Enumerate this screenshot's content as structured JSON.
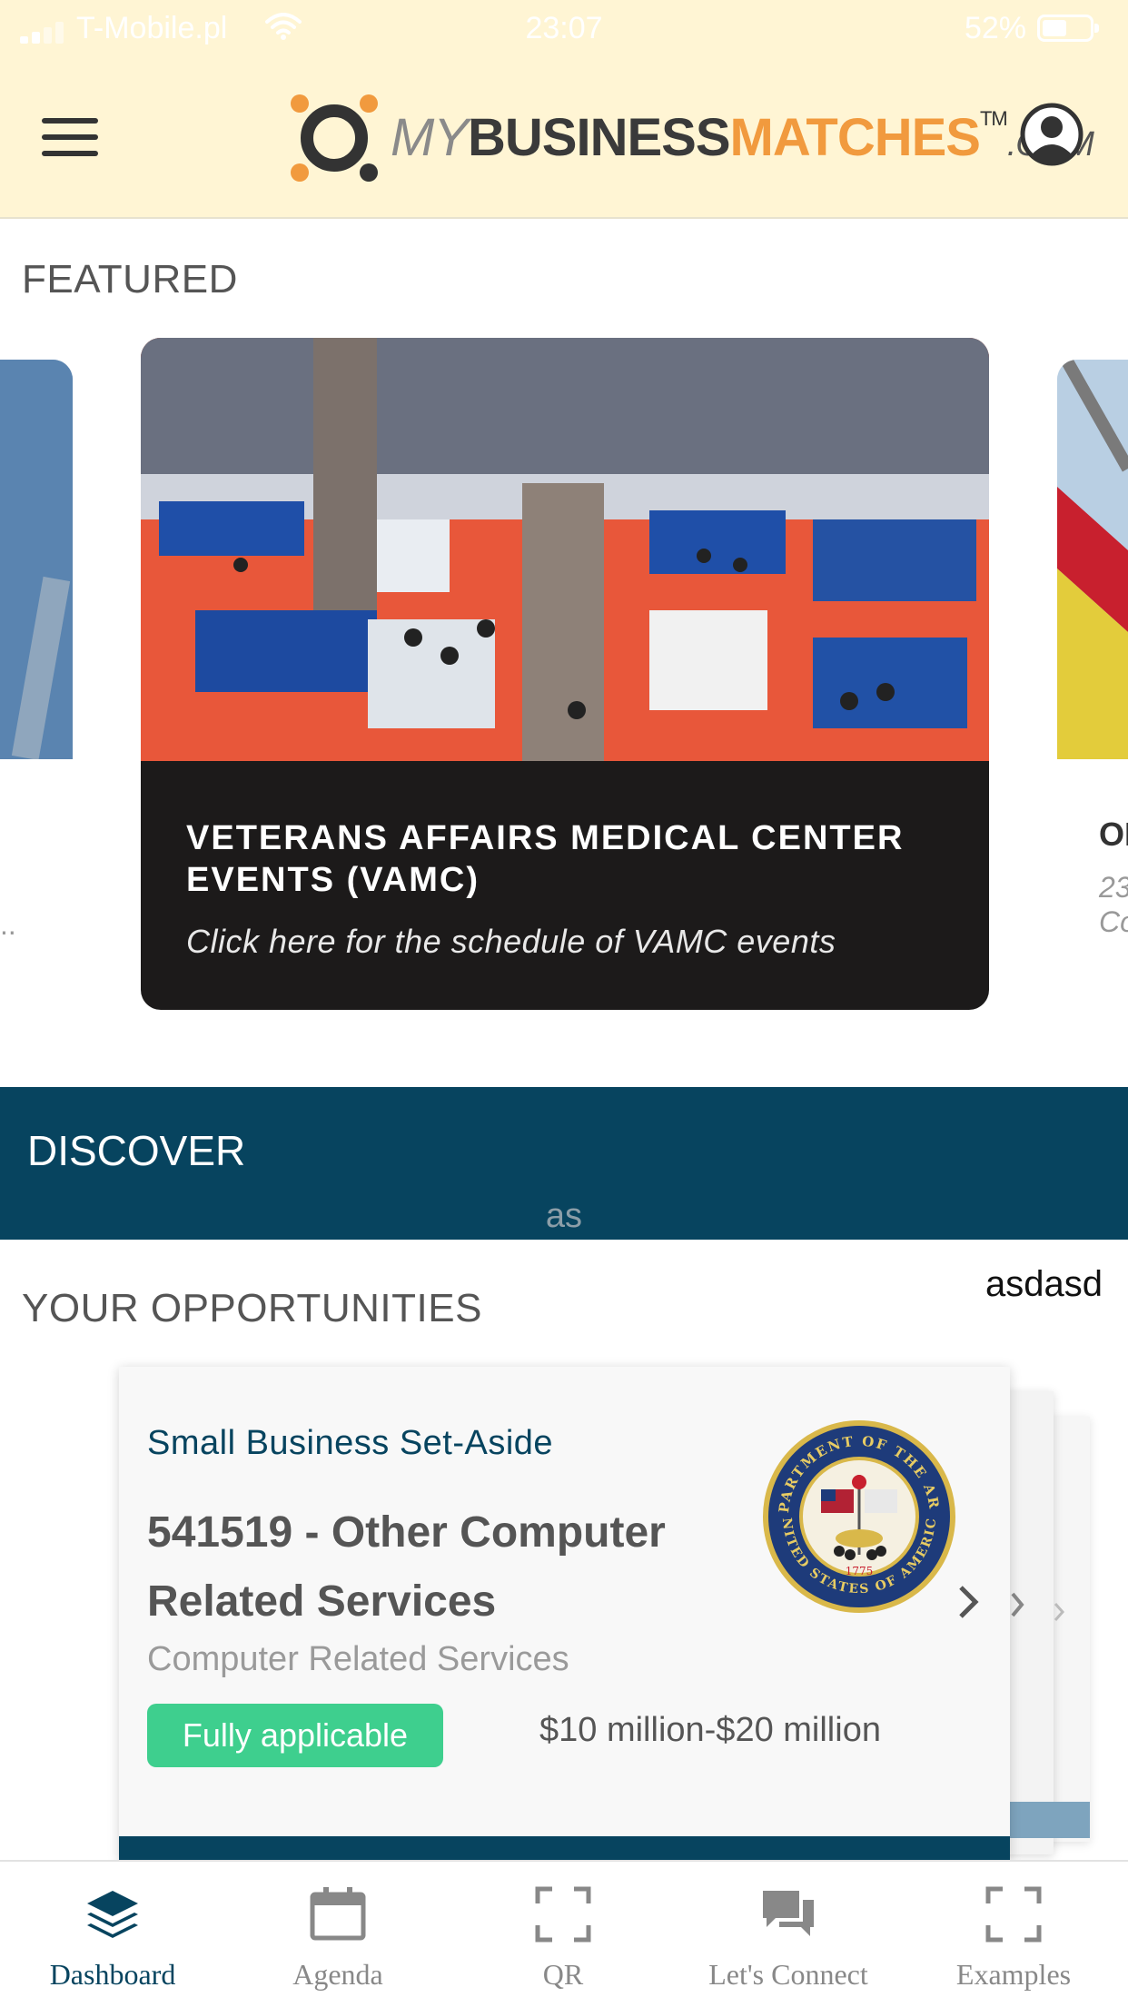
{
  "status_bar": {
    "carrier": "T-Mobile.pl",
    "time": "23:07",
    "battery": "52%"
  },
  "header": {
    "logo": {
      "my": "MY",
      "business": "BUSINESS",
      "matches": "MATCHES",
      "tm": "TM",
      "com": ".COM"
    },
    "icons": {
      "menu": "hamburger-menu-icon",
      "profile": "user-profile-icon"
    }
  },
  "featured": {
    "title": "FEATURED",
    "card": {
      "heading": "VETERANS AFFAIRS MEDICAL CENTER EVENTS (VAMC)",
      "subtitle": "Click here for the schedule of VAMC events"
    },
    "right_peek": {
      "title": "OI",
      "line1": "23",
      "line2": "Co"
    },
    "left_peek": {
      "text": ".."
    }
  },
  "discover": {
    "title": "DISCOVER",
    "caption": "as"
  },
  "opportunities": {
    "title": "YOUR OPPORTUNITIES",
    "extra_text": "asdasd",
    "card": {
      "type": "Small Business Set-Aside",
      "name": "541519 - Other Computer Related Services",
      "subtitle": "Computer Related Services",
      "badge": "Fully applicable",
      "value": "$10 million-$20 million",
      "seal": {
        "top": "DEPARTMENT OF THE ARMY",
        "bottom": "UNITED STATES OF AMERICA",
        "year": "1775"
      }
    }
  },
  "tabbar": {
    "tabs": [
      {
        "label": "Dashboard",
        "icon": "layers-icon",
        "active": true
      },
      {
        "label": "Agenda",
        "icon": "calendar-icon",
        "active": false
      },
      {
        "label": "QR",
        "icon": "qr-scan-icon",
        "active": false
      },
      {
        "label": "Let's Connect",
        "icon": "chat-bubbles-icon",
        "active": false
      },
      {
        "label": "Examples",
        "icon": "scan-frame-icon",
        "active": false
      }
    ]
  },
  "colors": {
    "header_bg": "#fff5d4",
    "brand_navy": "#07445f",
    "brand_orange": "#f19a3e",
    "badge_green": "#3ecf8e",
    "card_dark": "#1c1a1a"
  }
}
